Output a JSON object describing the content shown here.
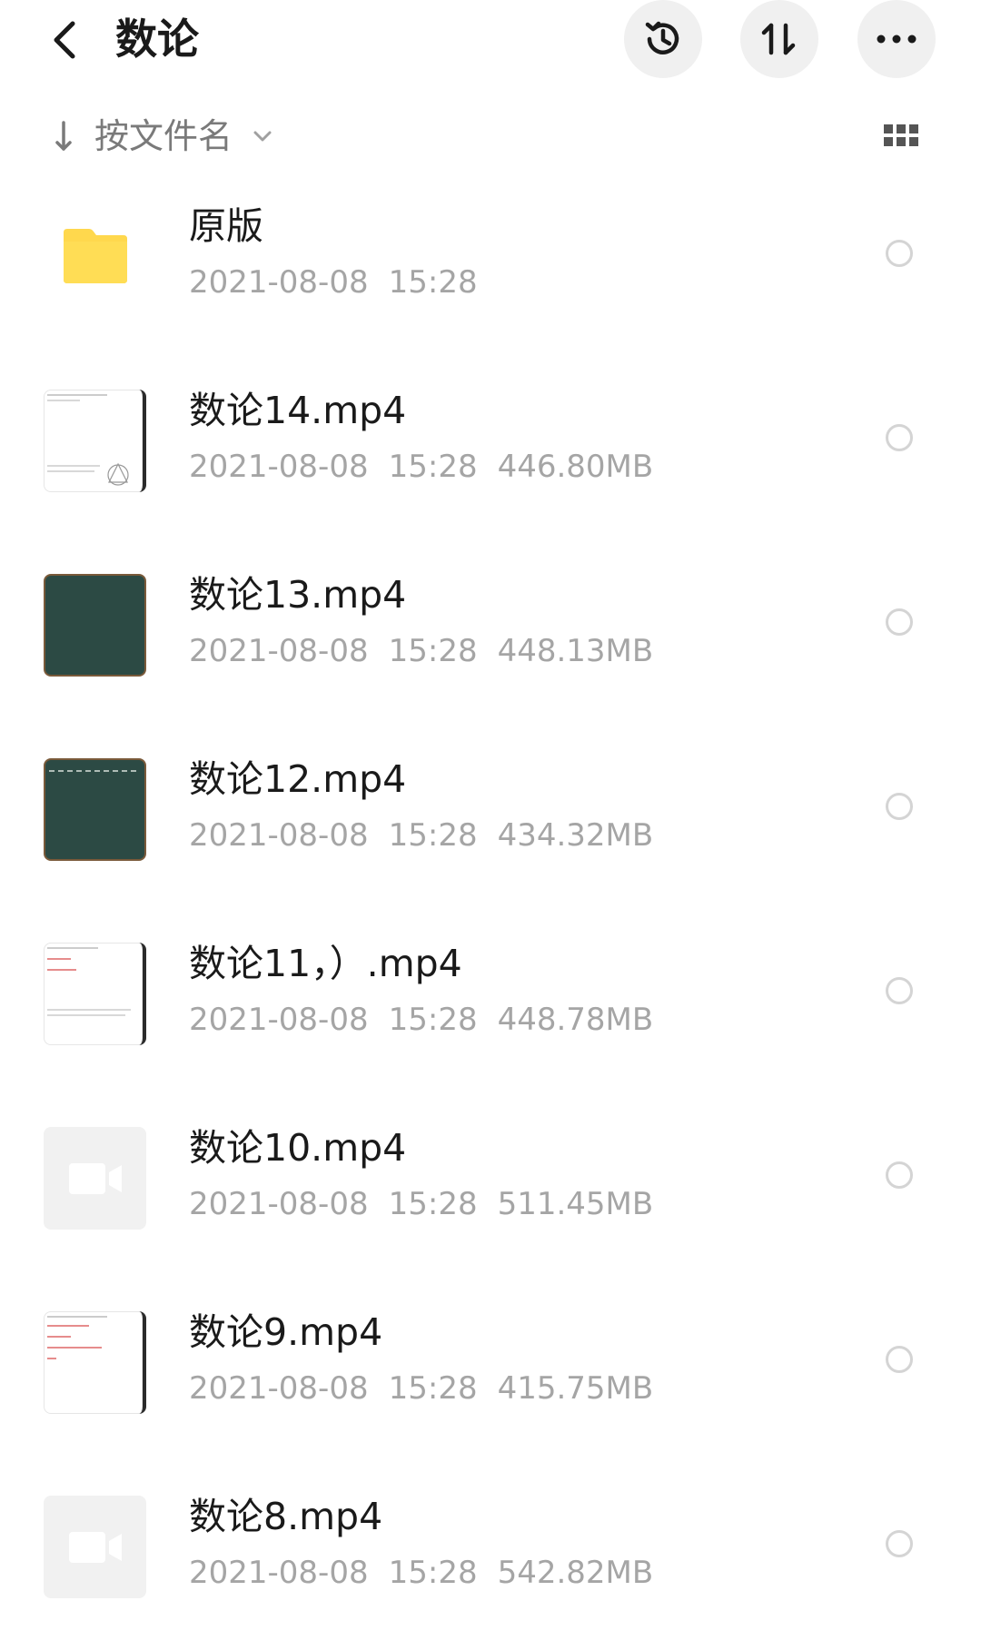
{
  "header": {
    "title": "数论",
    "back_icon": "chevron-left-icon",
    "history_icon": "history-icon",
    "sort_icon": "sort-order-icon",
    "more_icon": "more-dots-icon"
  },
  "sortbar": {
    "label": "按文件名",
    "direction_icon": "arrow-down-icon",
    "dropdown_icon": "chevron-down-icon",
    "view_toggle_icon": "grid-view-icon"
  },
  "colors": {
    "folder": "#FFD84D",
    "meta_text": "#A5A5A5",
    "chalkboard": "#2C4A44"
  },
  "files": [
    {
      "name": "原版",
      "date": "2021-08-08",
      "time": "15:28",
      "size": "",
      "type": "folder",
      "thumb": "folder-icon"
    },
    {
      "name": "数论14.mp4",
      "date": "2021-08-08",
      "time": "15:28",
      "size": "446.80MB",
      "type": "video",
      "thumb": "paper"
    },
    {
      "name": "数论13.mp4",
      "date": "2021-08-08",
      "time": "15:28",
      "size": "448.13MB",
      "type": "video",
      "thumb": "board"
    },
    {
      "name": "数论12.mp4",
      "date": "2021-08-08",
      "time": "15:28",
      "size": "434.32MB",
      "type": "video",
      "thumb": "board"
    },
    {
      "name": "数论11，）.mp4",
      "date": "2021-08-08",
      "time": "15:28",
      "size": "448.78MB",
      "type": "video",
      "thumb": "paper"
    },
    {
      "name": "数论10.mp4",
      "date": "2021-08-08",
      "time": "15:28",
      "size": "511.45MB",
      "type": "video",
      "thumb": "placeholder"
    },
    {
      "name": "数论9.mp4",
      "date": "2021-08-08",
      "time": "15:28",
      "size": "415.75MB",
      "type": "video",
      "thumb": "paper"
    },
    {
      "name": "数论8.mp4",
      "date": "2021-08-08",
      "time": "15:28",
      "size": "542.82MB",
      "type": "video",
      "thumb": "placeholder"
    }
  ]
}
